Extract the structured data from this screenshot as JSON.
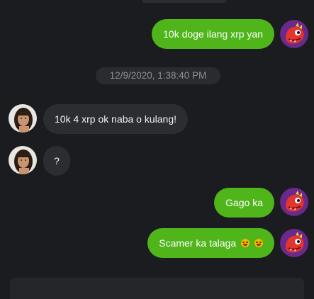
{
  "colors": {
    "background": "#1b1c1f",
    "outgoing_bubble": "#4fb51b",
    "incoming_bubble": "#2c2d31",
    "timestamp_text": "#8d8f94"
  },
  "messages": [
    {
      "direction": "outgoing",
      "text": "10k doge ilang xrp yan",
      "avatar": "red-dinosaur-avatar"
    },
    {
      "direction": "system",
      "timestamp": "12/9/2020, 1:38:40 PM"
    },
    {
      "direction": "incoming",
      "text": "10k 4 xrp ok naba o kulang!",
      "avatar": "woman-photo-avatar"
    },
    {
      "direction": "incoming",
      "text": "?",
      "avatar": "woman-photo-avatar"
    },
    {
      "direction": "outgoing",
      "text": "Gago ka",
      "avatar": "red-dinosaur-avatar"
    },
    {
      "direction": "outgoing",
      "text": "Scamer ka talaga",
      "emoji": [
        "grinning-sweat-emoji",
        "grinning-sweat-emoji"
      ],
      "avatar": "red-dinosaur-avatar"
    }
  ]
}
